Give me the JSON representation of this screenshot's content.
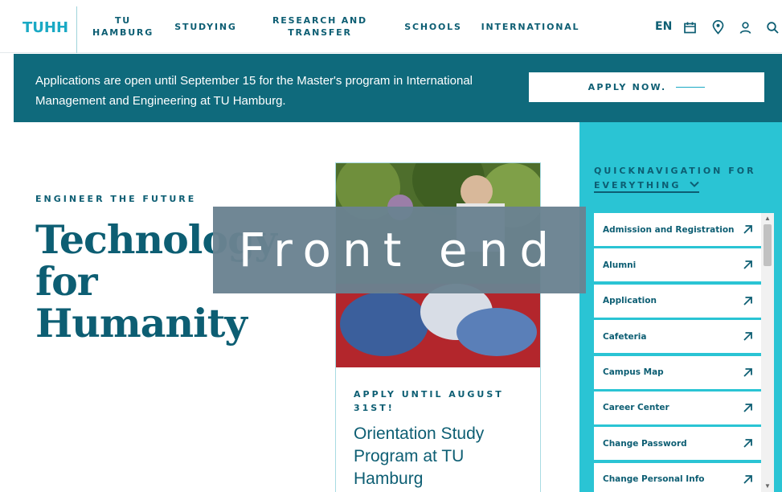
{
  "header": {
    "logo": "TUHH",
    "nav": [
      {
        "label_line1": "TU",
        "label_line2": "HAMBURG"
      },
      {
        "label_line1": "STUDYING",
        "label_line2": ""
      },
      {
        "label_line1": "RESEARCH AND",
        "label_line2": "TRANSFER"
      },
      {
        "label_line1": "SCHOOLS",
        "label_line2": ""
      },
      {
        "label_line1": "INTERNATIONAL",
        "label_line2": ""
      }
    ],
    "lang": "EN",
    "icons": [
      "calendar-icon",
      "location-pin-icon",
      "user-icon",
      "search-icon"
    ]
  },
  "banner": {
    "text": "Applications are open until September 15 for the Master's program in International Management and Engineering at TU Hamburg.",
    "button_label": "APPLY NOW."
  },
  "hero": {
    "eyebrow": "ENGINEER THE FUTURE",
    "title_line1": "Technology",
    "title_line2": "for",
    "title_line3": "Humanity"
  },
  "card": {
    "eyebrow": "APPLY UNTIL AUGUST 31ST!",
    "title": "Orientation Study Program at TU Hamburg"
  },
  "overlay": {
    "text": "Front end"
  },
  "quicknav": {
    "title_line1": "QUICKNAVIGATION FOR",
    "title_line2": "EVERYTHING",
    "items": [
      {
        "label": "Admission and Registration"
      },
      {
        "label": "Alumni"
      },
      {
        "label": "Application"
      },
      {
        "label": "Cafeteria"
      },
      {
        "label": "Campus Map"
      },
      {
        "label": "Career Center"
      },
      {
        "label": "Change Password"
      },
      {
        "label": "Change Personal Info"
      }
    ]
  },
  "colors": {
    "primary": "#0d5e73",
    "accent": "#1aa9c4",
    "banner": "#0f6a7c",
    "panel": "#2ac4d4",
    "overlay": "#6a8291"
  }
}
